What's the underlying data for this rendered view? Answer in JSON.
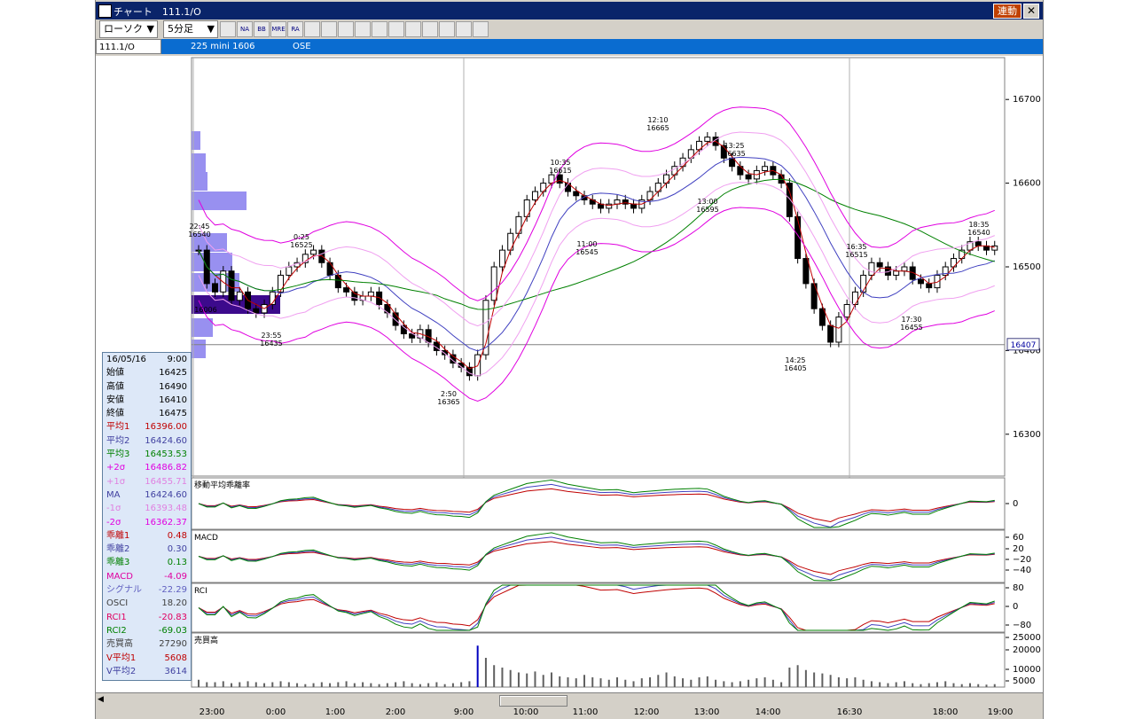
{
  "window": {
    "title": "チャート　111.1/O",
    "link_button": "連動",
    "close_glyph": "✕"
  },
  "toolbar": {
    "chart_type": "ローソク",
    "interval": "5分足",
    "icons": [
      "layout-icon",
      "na-icon",
      "bb-icon",
      "mre-icon",
      "ra-icon",
      "trend-icon",
      "cross-icon",
      "search-icon",
      "select-icon",
      "range-icon",
      "pen-icon",
      "cursor-icon",
      "eraser-icon",
      "copy-icon",
      "zoom-icon",
      "delete-icon"
    ],
    "icon_labels": [
      "",
      "NA",
      "BB",
      "MRE",
      "RA",
      "",
      "",
      "",
      "",
      "",
      "",
      "",
      "",
      "",
      "",
      ""
    ]
  },
  "infobar": {
    "symbol": "111.1/O",
    "contract": "225 mini 1606",
    "exchange": "OSE"
  },
  "price_axis": {
    "ticks": [
      "16700",
      "16600",
      "16500",
      "16400",
      "16300"
    ],
    "current": "16407"
  },
  "annotations": [
    {
      "time": "22:45",
      "price": "16540"
    },
    {
      "time": "0:25",
      "price": "16525"
    },
    {
      "time": "",
      "price": "16006"
    },
    {
      "time": "23:55",
      "price": "16435"
    },
    {
      "time": "2:50",
      "price": "16365"
    },
    {
      "time": "10:35",
      "price": "16615"
    },
    {
      "time": "11:00",
      "price": "16545"
    },
    {
      "time": "12:10",
      "price": "16665"
    },
    {
      "time": "13:25",
      "price": "16635"
    },
    {
      "time": "13:00",
      "price": "16595"
    },
    {
      "time": "14:25",
      "price": "16405"
    },
    {
      "time": "16:35",
      "price": "16515"
    },
    {
      "time": "17:30",
      "price": "16455"
    },
    {
      "time": "18:35",
      "price": "16540"
    }
  ],
  "panels": {
    "deviation": {
      "title": "移動平均乖離率",
      "ticks": [
        "0"
      ]
    },
    "macd": {
      "title": "MACD",
      "ticks": [
        "60",
        "20",
        "−20",
        "−40"
      ]
    },
    "rci": {
      "title": "RCI",
      "ticks": [
        "80",
        "0",
        "−80"
      ]
    },
    "volume": {
      "title": "売買高",
      "ticks": [
        "25000",
        "20000",
        "10000",
        "5000"
      ]
    }
  },
  "info_panel": {
    "date": "16/05/16",
    "time": "9:00",
    "rows": [
      {
        "k": "始値",
        "v": "16425",
        "color": "#000000"
      },
      {
        "k": "高値",
        "v": "16490",
        "color": "#000000"
      },
      {
        "k": "安値",
        "v": "16410",
        "color": "#000000"
      },
      {
        "k": "終値",
        "v": "16475",
        "color": "#000000"
      },
      {
        "k": "平均1",
        "v": "16396.00",
        "color": "#c00000"
      },
      {
        "k": "平均2",
        "v": "16424.60",
        "color": "#4040a0"
      },
      {
        "k": "平均3",
        "v": "16453.53",
        "color": "#008000"
      },
      {
        "k": "+2σ",
        "v": "16486.82",
        "color": "#e000e0"
      },
      {
        "k": "+1σ",
        "v": "16455.71",
        "color": "#e080e0"
      },
      {
        "k": "MA",
        "v": "16424.60",
        "color": "#4040a0"
      },
      {
        "k": "-1σ",
        "v": "16393.48",
        "color": "#e080e0"
      },
      {
        "k": "-2σ",
        "v": "16362.37",
        "color": "#e000e0"
      },
      {
        "k": "乖離1",
        "v": "0.48",
        "color": "#c00000"
      },
      {
        "k": "乖離2",
        "v": "0.30",
        "color": "#4040a0"
      },
      {
        "k": "乖離3",
        "v": "0.13",
        "color": "#008000"
      },
      {
        "k": "MACD",
        "v": "-4.09",
        "color": "#e000a0"
      },
      {
        "k": "シグナル",
        "v": "-22.29",
        "color": "#6060c0"
      },
      {
        "k": "OSCI",
        "v": "18.20",
        "color": "#404040"
      },
      {
        "k": "RCI1",
        "v": "-20.83",
        "color": "#e00060"
      },
      {
        "k": "RCI2",
        "v": "-69.03",
        "color": "#008000"
      },
      {
        "k": "売買高",
        "v": "27290",
        "color": "#404040"
      },
      {
        "k": "V平均1",
        "v": "5608",
        "color": "#c00000"
      },
      {
        "k": "V平均2",
        "v": "3614",
        "color": "#4040a0"
      }
    ]
  },
  "x_axis": [
    "23:00",
    "0:00",
    "1:00",
    "2:00",
    "9:00",
    "10:00",
    "11:00",
    "12:00",
    "13:00",
    "14:00",
    "16:30",
    "18:00",
    "19:00"
  ],
  "chart_data": {
    "type": "candlestick",
    "ylim": [
      16250,
      16750
    ],
    "close": [
      16520,
      16480,
      16470,
      16495,
      16460,
      16470,
      16450,
      16445,
      16455,
      16470,
      16490,
      16500,
      16505,
      16515,
      16520,
      16505,
      16490,
      16475,
      16470,
      16460,
      16465,
      16470,
      16455,
      16445,
      16430,
      16420,
      16415,
      16425,
      16410,
      16400,
      16395,
      16385,
      16380,
      16370,
      16395,
      16460,
      16500,
      16520,
      16540,
      16560,
      16580,
      16590,
      16600,
      16610,
      16600,
      16590,
      16585,
      16580,
      16575,
      16570,
      16575,
      16580,
      16575,
      16570,
      16580,
      16590,
      16600,
      16610,
      16620,
      16630,
      16640,
      16650,
      16655,
      16645,
      16630,
      16620,
      16610,
      16605,
      16615,
      16620,
      16610,
      16600,
      16560,
      16510,
      16480,
      16450,
      16430,
      16410,
      16440,
      16455,
      16470,
      16490,
      16505,
      16500,
      16490,
      16495,
      16500,
      16485,
      16480,
      16475,
      16490,
      16500,
      16510,
      16520,
      16530,
      16525,
      16520,
      16525
    ],
    "volume_levels": [
      0.15,
      0.1,
      0.1,
      0.12,
      0.08,
      0.1,
      0.12,
      0.1,
      0.08,
      0.1,
      0.12,
      0.1,
      0.08,
      0.06,
      0.08,
      0.1,
      0.08,
      0.1,
      0.12,
      0.08,
      0.1,
      0.08,
      0.06,
      0.08,
      0.1,
      0.12,
      0.08,
      0.06,
      0.08,
      0.1,
      0.06,
      0.08,
      0.1,
      0.12,
      0.85,
      0.6,
      0.45,
      0.4,
      0.35,
      0.3,
      0.28,
      0.32,
      0.25,
      0.3,
      0.22,
      0.2,
      0.18,
      0.25,
      0.2,
      0.18,
      0.15,
      0.2,
      0.15,
      0.12,
      0.18,
      0.2,
      0.25,
      0.3,
      0.22,
      0.18,
      0.15,
      0.2,
      0.22,
      0.15,
      0.12,
      0.1,
      0.12,
      0.15,
      0.18,
      0.2,
      0.15,
      0.1,
      0.4,
      0.45,
      0.35,
      0.3,
      0.28,
      0.25,
      0.2,
      0.18,
      0.2,
      0.15,
      0.12,
      0.1,
      0.08,
      0.1,
      0.12,
      0.08,
      0.06,
      0.08,
      0.1,
      0.12,
      0.08,
      0.06,
      0.08,
      0.06,
      0.05,
      0.06
    ]
  }
}
